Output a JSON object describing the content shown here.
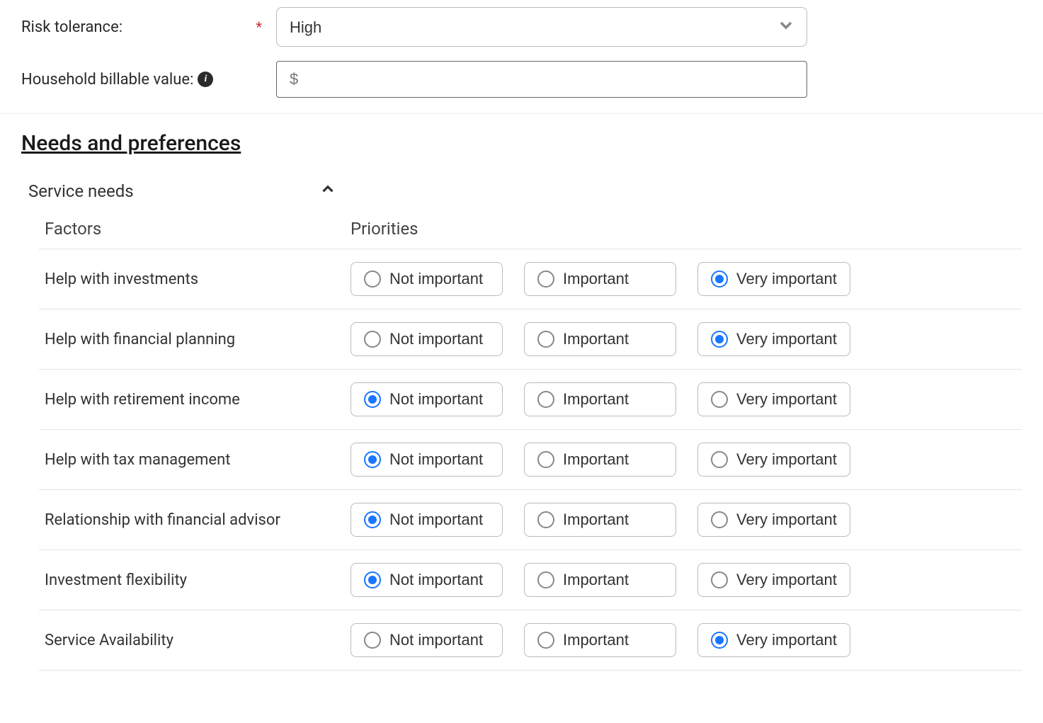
{
  "fields": {
    "risk_tolerance": {
      "label": "Risk tolerance:",
      "value": "High",
      "required": true
    },
    "household_billable": {
      "label": "Household billable value:",
      "placeholder": "$",
      "value": ""
    }
  },
  "section": {
    "title": "Needs and preferences",
    "subsection_title": "Service needs"
  },
  "table": {
    "header_factors": "Factors",
    "header_priorities": "Priorities",
    "priority_options": {
      "not_important": "Not important",
      "important": "Important",
      "very_important": "Very important"
    },
    "rows": [
      {
        "label": "Help with investments",
        "selected": "very_important"
      },
      {
        "label": "Help with financial planning",
        "selected": "very_important"
      },
      {
        "label": "Help with retirement income",
        "selected": "not_important"
      },
      {
        "label": "Help with tax management",
        "selected": "not_important"
      },
      {
        "label": "Relationship with financial advisor",
        "selected": "not_important"
      },
      {
        "label": "Investment flexibility",
        "selected": "not_important"
      },
      {
        "label": "Service Availability",
        "selected": "very_important"
      }
    ]
  }
}
